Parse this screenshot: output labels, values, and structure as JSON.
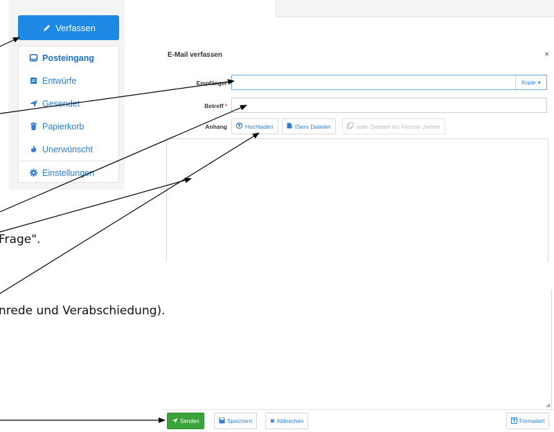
{
  "sidebar": {
    "compose_label": "Verfassen",
    "items": [
      {
        "label": "Posteingang",
        "icon": "inbox-icon"
      },
      {
        "label": "Entwürfe",
        "icon": "draft-icon"
      },
      {
        "label": "Gesendet",
        "icon": "send-icon"
      },
      {
        "label": "Papierkorb",
        "icon": "trash-icon"
      },
      {
        "label": "Unerwünscht",
        "icon": "fire-icon"
      },
      {
        "label": "Einstellungen",
        "icon": "gear-icon"
      }
    ]
  },
  "dialog": {
    "title": "E-Mail verfassen",
    "close": "×",
    "recipient_label": "Empfänger",
    "recipient_value": "",
    "kopie_label": "Kopie",
    "subject_label": "Betreff",
    "subject_required": "*",
    "subject_value": "",
    "attachment_label": "Anhang",
    "upload_label": "Hochladen",
    "iserv_label": "IServ Dateien",
    "drop_label": "oder Dateien ins Fenster ziehen",
    "body_text": ""
  },
  "footer": {
    "send": "Senden",
    "save": "Speichern",
    "cancel": "Abbrechen",
    "format": "Formatiert"
  },
  "captions": {
    "line1": "Frage\".",
    "line2": "nrede und Verabschiedung)."
  },
  "colors": {
    "primary": "#1e88e5",
    "link": "#2a7fd0",
    "send": "#3aa33a",
    "required": "#d9534f"
  }
}
